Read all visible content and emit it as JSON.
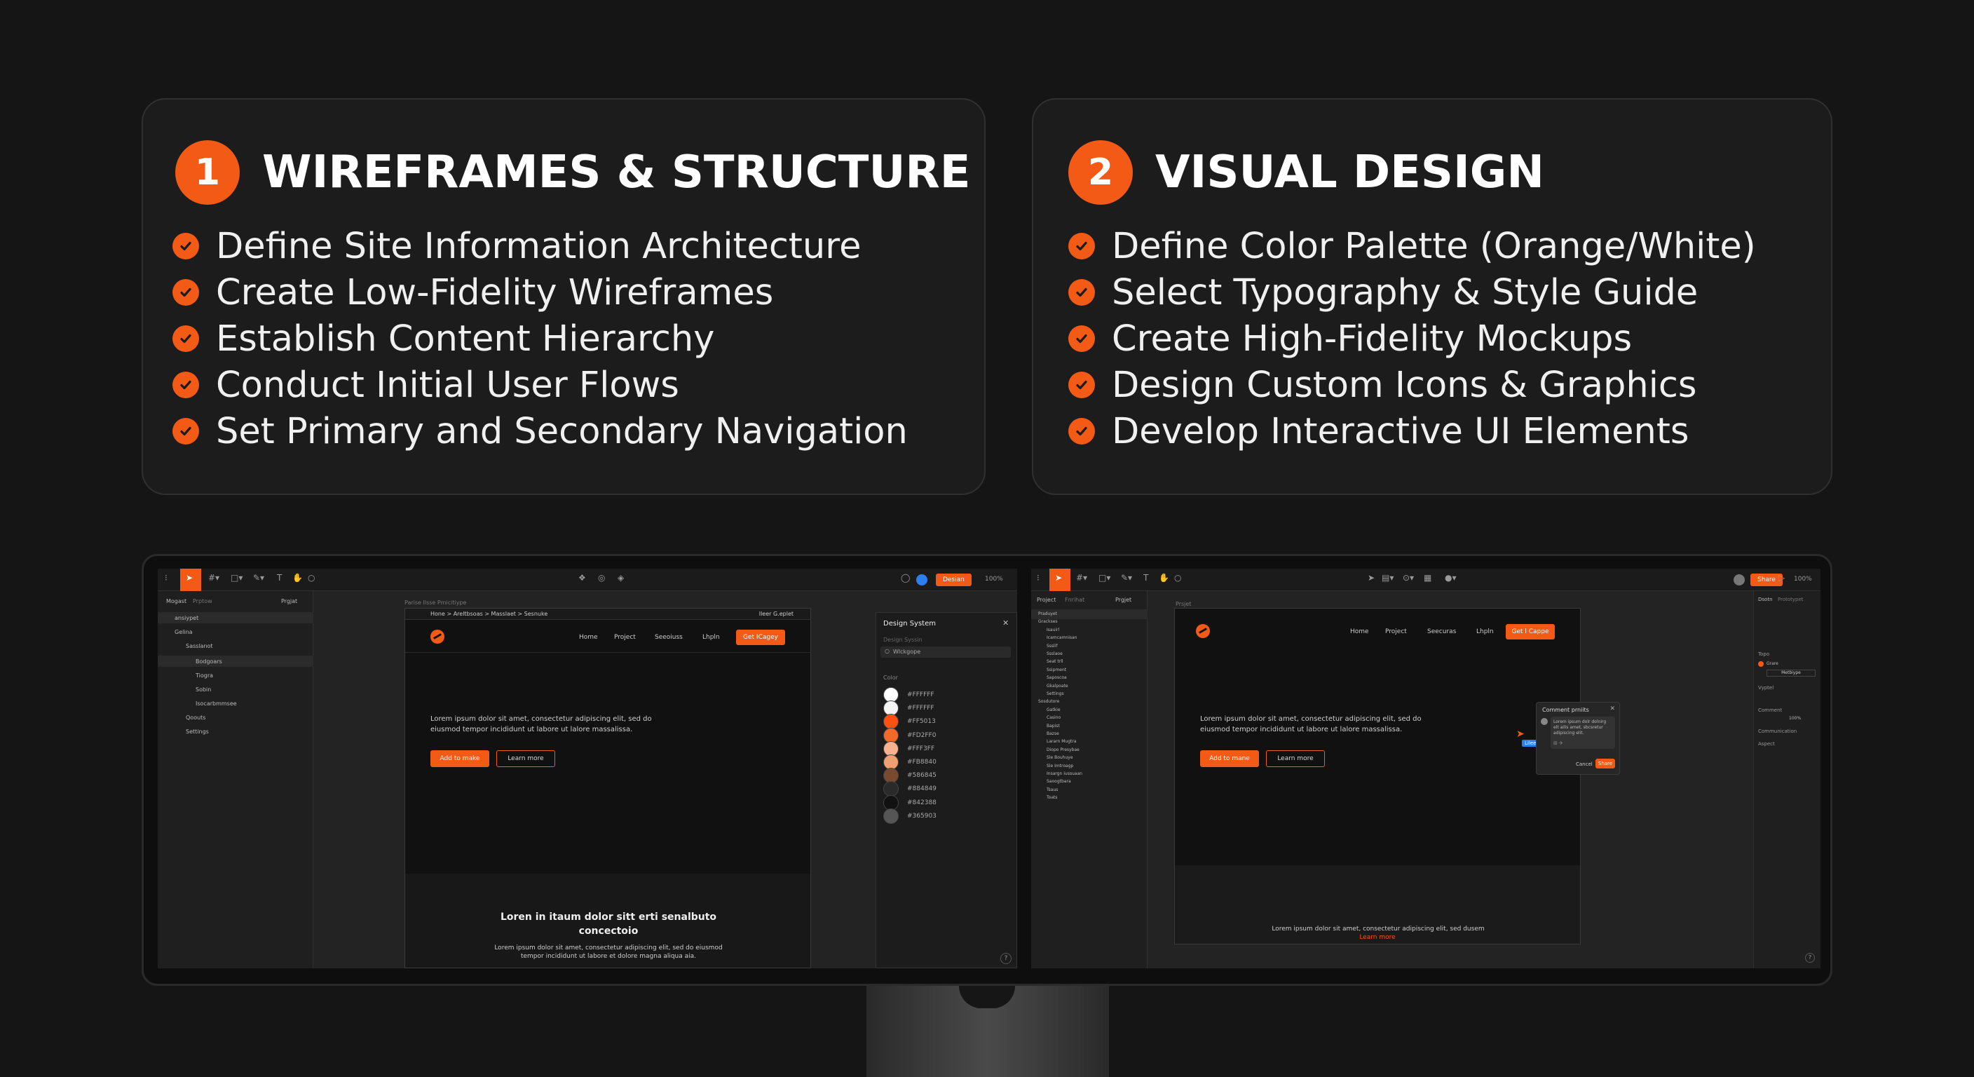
{
  "card1": {
    "number": "1",
    "title": "WIREFRAMES & STRUCTURE",
    "items": [
      "Define Site Information Architecture",
      "Create Low-Fidelity Wireframes",
      "Establish Content Hierarchy",
      "Conduct Initial User Flows",
      "Set Primary and Secondary Navigation"
    ]
  },
  "card2": {
    "number": "2",
    "title": "VISUAL DESIGN",
    "items": [
      "Define Color Palette (Orange/White)",
      "Select Typography & Style Guide",
      "Create High-Fidelity Mockups",
      "Design Custom Icons & Graphics",
      "Develop Interactive UI Elements"
    ]
  },
  "accent": "#f25a15",
  "screen1": {
    "share": "Desian",
    "zoom": "100%",
    "tabs": [
      "Mogast",
      "Prptow"
    ],
    "page_select": "Prgjat",
    "layers": [
      "ansiypet",
      "Gelina",
      "Sasslanot",
      "Bodgoars",
      "Tiogra",
      "Sobin",
      "Isocarbmmsee",
      "Qoouts",
      "Settings"
    ],
    "frame_label": "Parise Ilsse Pmicitiype",
    "breadcrumb": "Hone  >  Areltbsoas  >  Masslaet  >  Sesnuke",
    "breadcrumb_right": "Ileer G.eplet",
    "nav": [
      "Home",
      "Project",
      "Seeoiuss",
      "Lhpln"
    ],
    "cta": "Get ICagey",
    "hero_text": "Lorem ipsum dolor sit amet, consectetur adipiscing elit, sed do eiusmod tempor incididunt ut labore ut lalore massalissa.",
    "btn_primary": "Add to make",
    "btn_secondary": "Learn more",
    "section_title": "Loren in itaum dolor sitt erti senalbuto concectoio",
    "section_text": "Lorem ipsum dolor sit amet, consectetur adipiscing elit, sed do eiusmod tempor incididunt ut labore et dolore magna aliqua aia.",
    "panel_title": "Design System",
    "panel_sub": "Design Syssin",
    "panel_search": "Wlckgope",
    "color_heading": "Color",
    "swatches": [
      {
        "label": "#FFFFFF",
        "color": "#ffffff"
      },
      {
        "label": "#FFFFFF",
        "color": "#f5f5f5"
      },
      {
        "label": "#FF5013",
        "color": "#ff5013"
      },
      {
        "label": "#FD2FF0",
        "color": "#f26a2a"
      },
      {
        "label": "#FFF3FF",
        "color": "#f7b38f"
      },
      {
        "label": "#FB8840",
        "color": "#f0a070"
      },
      {
        "label": "#586845",
        "color": "#7a4a30"
      },
      {
        "label": "#884849",
        "color": "#2a2a2a"
      },
      {
        "label": "#842388",
        "color": "#111111"
      },
      {
        "label": "#365903",
        "color": "#555555"
      }
    ]
  },
  "screen2": {
    "share": "Share",
    "zoom": "100%",
    "tabs": [
      "Project",
      "Fnrihat"
    ],
    "page_select": "Prgjet",
    "layers": [
      "Praduyet",
      "Grackses",
      "Isauirl",
      "Icamcamnisan",
      "Ssslif",
      "Ssslaoe",
      "Seat trll",
      "Ssipment",
      "Saposcoa",
      "Gkalpoate",
      "Settings",
      "Sosdutore",
      "Gatkie",
      "Casino",
      "Bapist",
      "Bazse",
      "Lararn Mugtra",
      "Diopo Presybae",
      "Sle Bouhuye",
      "Sle Imtroagp",
      "Insargn iussuaan",
      "Saoogtbara",
      "Tsaus",
      "Toats"
    ],
    "frame_label": "Prsjet",
    "nav": [
      "Home",
      "Project",
      "Seecuras",
      "Lhpln"
    ],
    "cta": "Get l Cappe",
    "hero_text": "Lorem ipsum dolor sit amet, consectetur adipiscing elit, sed do eiusmod tempor incididunt ut labore ut lalore massalissa.",
    "btn_primary": "Add to mane",
    "btn_secondary": "Learn more",
    "section_text": "Lorem ipsum dolor sit amet, consectetur adipiscing elit, sed dusem",
    "section_link": "Learn more",
    "comment_title": "Comment prniits",
    "comment_text": "Lorem ipsum dolr dolnirg elt ailis amet, sbcsretur adipiscing elit.",
    "comment_cancel": "Cancel",
    "comment_save": "Share",
    "cursor_label": "Lileel",
    "rp_tabs": [
      "Dsotn",
      "Prototypet"
    ],
    "rp_sections": [
      "Topo",
      "Vyptel",
      "Comment",
      "Communication",
      "Aspect"
    ],
    "rp_fill": "Grare",
    "rp_font": "Metbiype",
    "rp_opacity": "100%"
  }
}
